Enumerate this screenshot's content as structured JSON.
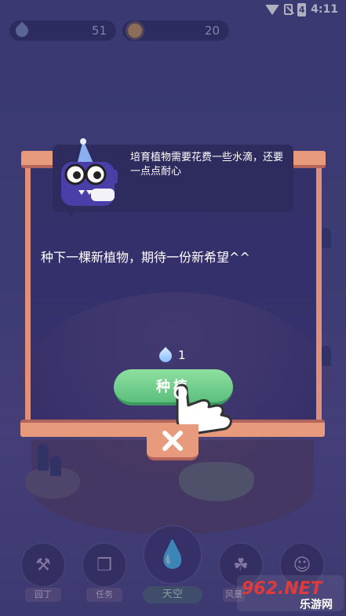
{
  "status_bar": {
    "time": "4:11",
    "battery_level": "4"
  },
  "counters": {
    "water": "51",
    "sun": "20"
  },
  "dialog": {
    "bubble_text": "培育植物需要花费一些水滴，还要一点点耐心",
    "main_text": "种下一棵新植物，期待一份新希望^^",
    "cost": "1",
    "plant_button": "种植"
  },
  "bottom_nav": {
    "garden": "园丁",
    "tasks": "任务",
    "sky": "天空",
    "landscape": "风景"
  },
  "watermark": {
    "logo": "962.NET",
    "subtitle": "乐游网"
  },
  "colors": {
    "frame": "#e89a7c",
    "plant_button": "#6fd08a",
    "background": "#4a4a8a"
  }
}
